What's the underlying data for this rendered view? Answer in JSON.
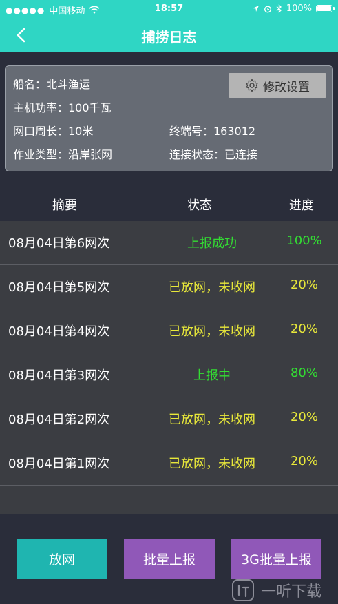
{
  "status_bar": {
    "carrier": "中国移动",
    "time": "18:57",
    "battery": "100%"
  },
  "nav": {
    "title": "捕捞日志"
  },
  "info": {
    "ship_name": "船名：北斗渔运",
    "engine_power": "主机功率：100千瓦",
    "net_perimeter": "网口周长：10米",
    "terminal_no": "终端号：163012",
    "work_type": "作业类型：沿岸张网",
    "connection": "连接状态：已连接",
    "settings_label": "修改设置"
  },
  "table": {
    "headers": [
      "摘要",
      "状态",
      "进度"
    ],
    "rows": [
      {
        "summary": "08月04日第6网次",
        "status": "上报成功",
        "progress": "100%"
      },
      {
        "summary": "08月04日第5网次",
        "status": "已放网，未收网",
        "progress": "20%"
      },
      {
        "summary": "08月04日第4网次",
        "status": "已放网，未收网",
        "progress": "20%"
      },
      {
        "summary": "08月04日第3网次",
        "status": "上报中",
        "progress": "80%"
      },
      {
        "summary": "08月04日第2网次",
        "status": "已放网，未收网",
        "progress": "20%"
      },
      {
        "summary": "08月04日第1网次",
        "status": "已放网，未收网",
        "progress": "20%"
      }
    ]
  },
  "buttons": {
    "cast_net": "放网",
    "batch_report": "批量上报",
    "batch_report_3g": "3G批量上报"
  },
  "watermark": {
    "text": "一听下载"
  },
  "colors": {
    "header": "#2fd6c4",
    "success": "#33dd33",
    "pending": "#e8e83a",
    "teal_button": "#1fb5b0",
    "purple_button": "#9058b8"
  }
}
